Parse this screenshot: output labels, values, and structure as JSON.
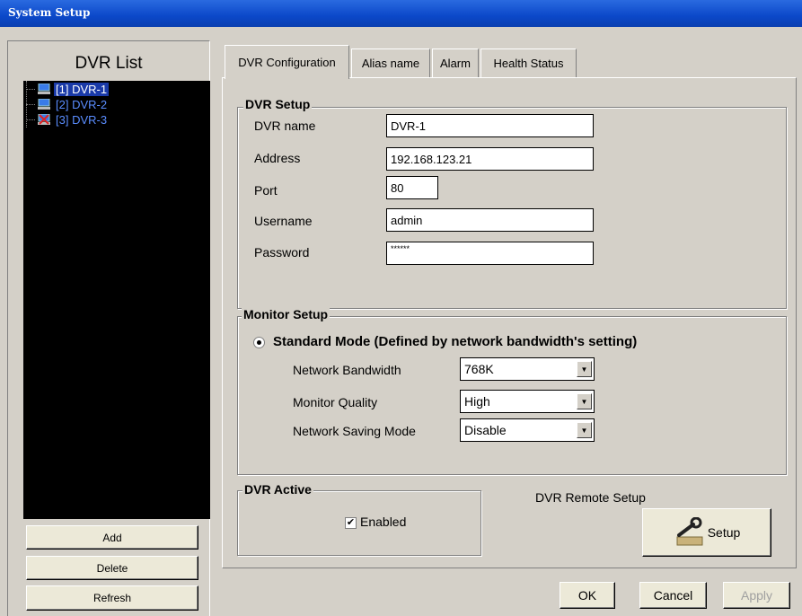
{
  "window": {
    "title": "System Setup"
  },
  "sidebar": {
    "title": "DVR List",
    "items": [
      {
        "label": "[1] DVR-1",
        "icon": "monitor-icon",
        "selected": true
      },
      {
        "label": "[2] DVR-2",
        "icon": "monitor-icon",
        "selected": false
      },
      {
        "label": "[3] DVR-3",
        "icon": "monitor-error-icon",
        "selected": false
      }
    ],
    "buttons": {
      "add": "Add",
      "delete": "Delete",
      "refresh": "Refresh"
    }
  },
  "tabs": [
    {
      "label": "DVR Configuration",
      "active": true
    },
    {
      "label": "Alias name",
      "active": false
    },
    {
      "label": "Alarm",
      "active": false
    },
    {
      "label": "Health Status",
      "active": false
    }
  ],
  "dvr_setup": {
    "title": "DVR Setup",
    "dvr_name": {
      "label": "DVR name",
      "value": "DVR-1"
    },
    "address": {
      "label": "Address",
      "value": "192.168.123.21"
    },
    "port": {
      "label": "Port",
      "value": "80"
    },
    "username": {
      "label": "Username",
      "value": "admin"
    },
    "password": {
      "label": "Password",
      "value": "******"
    }
  },
  "monitor_setup": {
    "title": "Monitor Setup",
    "mode_label": "Standard Mode (Defined by network bandwidth's setting)",
    "bandwidth": {
      "label": "Network Bandwidth",
      "value": "768K"
    },
    "quality": {
      "label": "Monitor Quality",
      "value": "High"
    },
    "saving": {
      "label": "Network Saving Mode",
      "value": "Disable"
    }
  },
  "dvr_active": {
    "title": "DVR Active",
    "enabled_label": "Enabled",
    "enabled_checked": true
  },
  "remote_setup": {
    "label": "DVR Remote Setup",
    "button": "Setup"
  },
  "footer": {
    "ok": "OK",
    "cancel": "Cancel",
    "apply": "Apply"
  },
  "colors": {
    "titlebar": "#0b48c9",
    "tree_bg": "#000000",
    "tree_text": "#5a8dff",
    "selected": "#1a3aa8"
  }
}
